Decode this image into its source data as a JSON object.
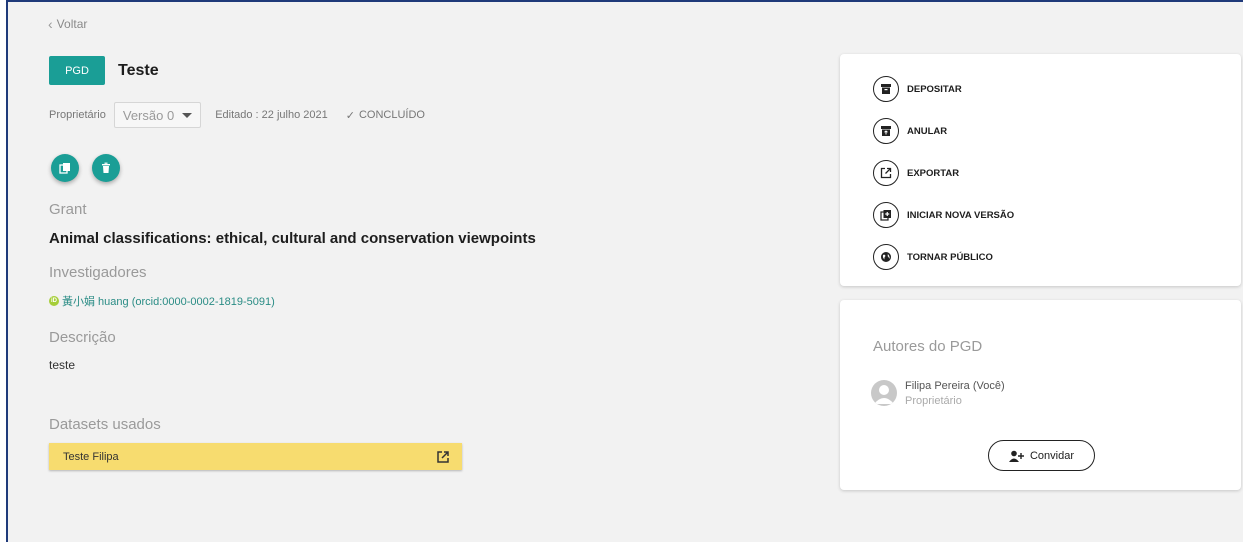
{
  "nav": {
    "back_label": "Voltar"
  },
  "plan": {
    "badge": "PGD",
    "title": "Teste",
    "owner_label": "Proprietário",
    "version": "Versão 0",
    "edited": "Editado : 22 julho 2021",
    "status": "CONCLUÍDO"
  },
  "grant": {
    "label": "Grant",
    "title": "Animal classifications: ethical, cultural and conservation viewpoints"
  },
  "investigators": {
    "label": "Investigadores",
    "items": [
      "黃小娟 huang (orcid:0000-0002-1819-5091)"
    ]
  },
  "description": {
    "label": "Descrição",
    "text": "teste"
  },
  "datasets": {
    "label": "Datasets usados",
    "items": [
      "Teste Filipa"
    ]
  },
  "actions": {
    "deposit": "DEPOSITAR",
    "cancel": "ANULAR",
    "export": "EXPORTAR",
    "new_version": "INICIAR NOVA VERSÃO",
    "make_public": "TORNAR PÚBLICO"
  },
  "authors": {
    "title": "Autores do PGD",
    "items": [
      {
        "name": "Filipa Pereira (Você)",
        "role": "Proprietário"
      }
    ],
    "invite_label": "Convidar"
  },
  "colors": {
    "accent": "#1a9e96",
    "dataset_bg": "#f7dc6f",
    "frame_border": "#1f3a7a"
  }
}
